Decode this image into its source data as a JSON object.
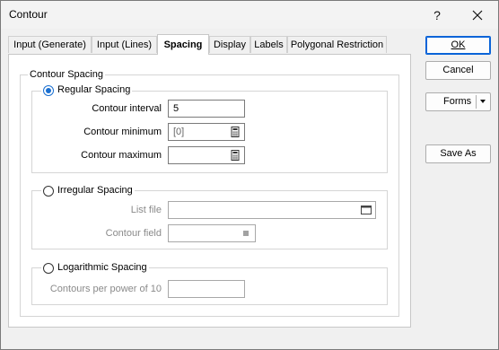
{
  "window": {
    "title": "Contour",
    "help_label": "?",
    "close_label": "✕"
  },
  "tabs": [
    {
      "label": "Input (Generate)"
    },
    {
      "label": "Input (Lines)"
    },
    {
      "label": "Spacing",
      "active": true
    },
    {
      "label": "Display"
    },
    {
      "label": "Labels"
    },
    {
      "label": "Polygonal Restriction"
    }
  ],
  "spacing": {
    "group_title": "Contour Spacing",
    "regular": {
      "label": "Regular Spacing",
      "selected": true,
      "interval_label": "Contour interval",
      "interval_value": "5",
      "minimum_label": "Contour minimum",
      "minimum_value": "[0]",
      "maximum_label": "Contour maximum",
      "maximum_value": ""
    },
    "irregular": {
      "label": "Irregular Spacing",
      "selected": false,
      "list_file_label": "List file",
      "contour_field_label": "Contour field"
    },
    "logarithmic": {
      "label": "Logarithmic Spacing",
      "selected": false,
      "per_power_label": "Contours per power of 10"
    }
  },
  "buttons": {
    "ok": "OK",
    "cancel": "Cancel",
    "forms": "Forms",
    "save_as": "Save As"
  },
  "colors": {
    "accent": "#1a6fd0",
    "window_bg": "#f0f0f0",
    "panel_bg": "#ffffff"
  }
}
